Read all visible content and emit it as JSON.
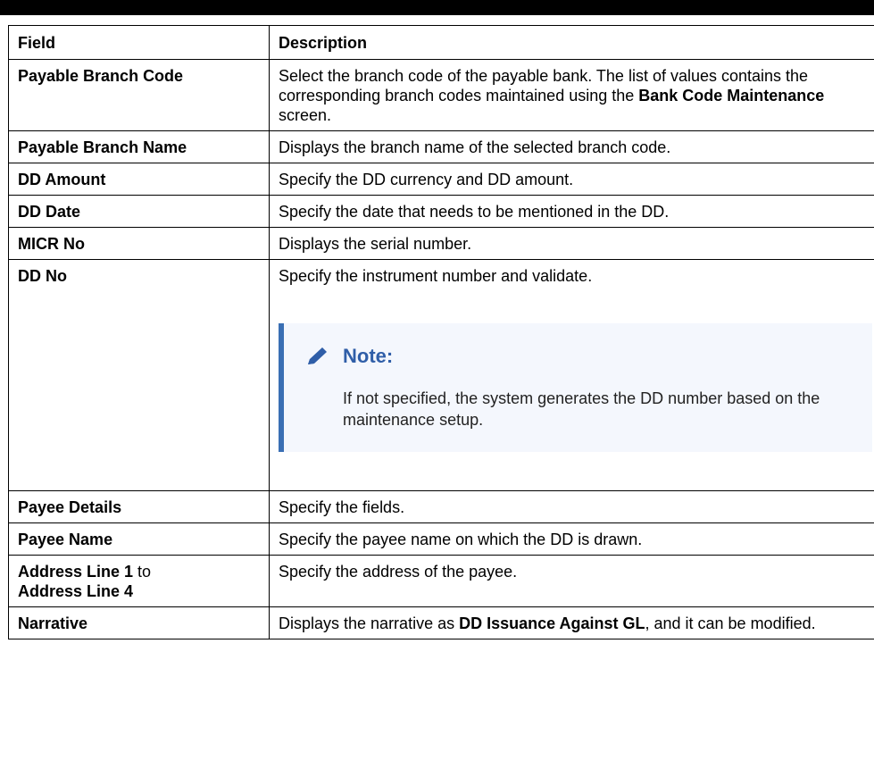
{
  "table": {
    "headers": {
      "field": "Field",
      "description": "Description"
    },
    "rows": {
      "payable_branch_code": {
        "field": "Payable Branch Code",
        "desc_prefix": "Select the branch code of the payable bank. The list of values contains the corresponding branch codes maintained using the ",
        "desc_bold": "Bank Code Maintenance",
        "desc_suffix": " screen."
      },
      "payable_branch_name": {
        "field": "Payable Branch Name",
        "desc": "Displays the branch name of the selected branch code."
      },
      "dd_amount": {
        "field": "DD Amount",
        "desc": "Specify the DD currency and DD amount."
      },
      "dd_date": {
        "field": "DD Date",
        "desc": "Specify the date that needs to be mentioned in the DD."
      },
      "micr_no": {
        "field": "MICR No",
        "desc": "Displays the serial number."
      },
      "dd_no": {
        "field": "DD No",
        "desc": "Specify the instrument number and validate.",
        "note_icon": "pencil-icon",
        "note_title": "Note:",
        "note_body": "If not specified, the system generates the DD number based on the maintenance setup."
      },
      "payee_details": {
        "field": "Payee Details",
        "desc": "Specify the fields."
      },
      "payee_name": {
        "field": "Payee Name",
        "desc": "Specify the payee name on which the DD is drawn."
      },
      "address_lines": {
        "field_part1": "Address Line 1",
        "field_part2": " to ",
        "field_part3": "Address Line 4",
        "desc": "Specify the address of the payee."
      },
      "narrative": {
        "field": "Narrative",
        "desc_prefix": "Displays the narrative as ",
        "desc_bold": "DD Issuance Against GL",
        "desc_suffix": ", and it can be modified."
      }
    }
  },
  "colors": {
    "note_accent": "#3a6fb4",
    "note_title": "#2f5ea8",
    "note_bg": "#f4f7fd"
  }
}
